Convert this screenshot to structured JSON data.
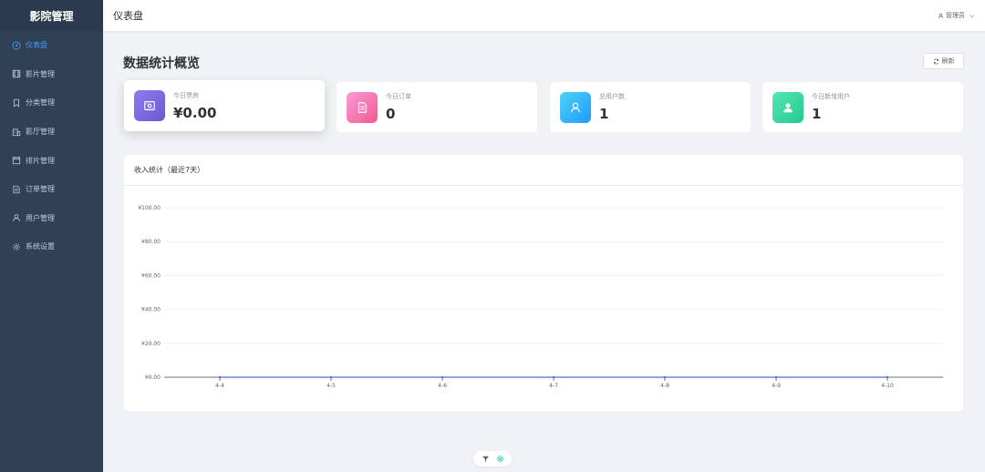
{
  "app": {
    "brand": "影院管理"
  },
  "sidebar": {
    "items": [
      {
        "label": "仪表盘",
        "icon": "dashboard-icon",
        "active": true
      },
      {
        "label": "影片管理",
        "icon": "film-icon"
      },
      {
        "label": "分类管理",
        "icon": "bookmark-icon"
      },
      {
        "label": "影厅管理",
        "icon": "building-icon"
      },
      {
        "label": "排片管理",
        "icon": "calendar-icon"
      },
      {
        "label": "订单管理",
        "icon": "document-icon"
      },
      {
        "label": "用户管理",
        "icon": "user-icon"
      },
      {
        "label": "系统设置",
        "icon": "gear-icon"
      }
    ]
  },
  "header": {
    "title": "仪表盘",
    "user": "管理员"
  },
  "main": {
    "section_title": "数据统计概览",
    "refresh_label": "刷新",
    "stats": [
      {
        "label": "今日票房",
        "value": "¥0.00",
        "icon": "wallet-icon",
        "gradient": [
          "#8a7cf0",
          "#6a5acd"
        ]
      },
      {
        "label": "今日订单",
        "value": "0",
        "icon": "document-icon",
        "gradient": [
          "#f89bd8",
          "#f35a8f"
        ]
      },
      {
        "label": "总用户数",
        "value": "1",
        "icon": "user-icon",
        "gradient": [
          "#4fd1f5",
          "#1e9cff"
        ]
      },
      {
        "label": "今日新增用户",
        "value": "1",
        "icon": "user-add-icon",
        "gradient": [
          "#55e8b3",
          "#22c98c"
        ]
      }
    ]
  },
  "chart_data": {
    "type": "line",
    "title": "收入统计（最近7天）",
    "categories": [
      "4-4",
      "4-5",
      "4-6",
      "4-7",
      "4-8",
      "4-9",
      "4-10"
    ],
    "series": [
      {
        "values": [
          0,
          0,
          0,
          0,
          0,
          0,
          0
        ]
      }
    ],
    "y_ticks": [
      "¥0.00",
      "¥20.00",
      "¥40.00",
      "¥60.00",
      "¥80.00",
      "¥100.00"
    ],
    "ylim": [
      0,
      100
    ],
    "grid": true
  }
}
